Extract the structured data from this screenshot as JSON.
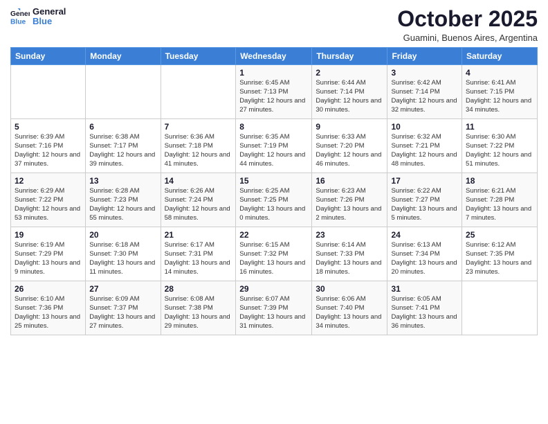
{
  "logo": {
    "line1": "General",
    "line2": "Blue"
  },
  "title": "October 2025",
  "subtitle": "Guamini, Buenos Aires, Argentina",
  "days_header": [
    "Sunday",
    "Monday",
    "Tuesday",
    "Wednesday",
    "Thursday",
    "Friday",
    "Saturday"
  ],
  "weeks": [
    [
      {
        "num": "",
        "info": ""
      },
      {
        "num": "",
        "info": ""
      },
      {
        "num": "",
        "info": ""
      },
      {
        "num": "1",
        "info": "Sunrise: 6:45 AM\nSunset: 7:13 PM\nDaylight: 12 hours\nand 27 minutes."
      },
      {
        "num": "2",
        "info": "Sunrise: 6:44 AM\nSunset: 7:14 PM\nDaylight: 12 hours\nand 30 minutes."
      },
      {
        "num": "3",
        "info": "Sunrise: 6:42 AM\nSunset: 7:14 PM\nDaylight: 12 hours\nand 32 minutes."
      },
      {
        "num": "4",
        "info": "Sunrise: 6:41 AM\nSunset: 7:15 PM\nDaylight: 12 hours\nand 34 minutes."
      }
    ],
    [
      {
        "num": "5",
        "info": "Sunrise: 6:39 AM\nSunset: 7:16 PM\nDaylight: 12 hours\nand 37 minutes."
      },
      {
        "num": "6",
        "info": "Sunrise: 6:38 AM\nSunset: 7:17 PM\nDaylight: 12 hours\nand 39 minutes."
      },
      {
        "num": "7",
        "info": "Sunrise: 6:36 AM\nSunset: 7:18 PM\nDaylight: 12 hours\nand 41 minutes."
      },
      {
        "num": "8",
        "info": "Sunrise: 6:35 AM\nSunset: 7:19 PM\nDaylight: 12 hours\nand 44 minutes."
      },
      {
        "num": "9",
        "info": "Sunrise: 6:33 AM\nSunset: 7:20 PM\nDaylight: 12 hours\nand 46 minutes."
      },
      {
        "num": "10",
        "info": "Sunrise: 6:32 AM\nSunset: 7:21 PM\nDaylight: 12 hours\nand 48 minutes."
      },
      {
        "num": "11",
        "info": "Sunrise: 6:30 AM\nSunset: 7:22 PM\nDaylight: 12 hours\nand 51 minutes."
      }
    ],
    [
      {
        "num": "12",
        "info": "Sunrise: 6:29 AM\nSunset: 7:22 PM\nDaylight: 12 hours\nand 53 minutes."
      },
      {
        "num": "13",
        "info": "Sunrise: 6:28 AM\nSunset: 7:23 PM\nDaylight: 12 hours\nand 55 minutes."
      },
      {
        "num": "14",
        "info": "Sunrise: 6:26 AM\nSunset: 7:24 PM\nDaylight: 12 hours\nand 58 minutes."
      },
      {
        "num": "15",
        "info": "Sunrise: 6:25 AM\nSunset: 7:25 PM\nDaylight: 13 hours\nand 0 minutes."
      },
      {
        "num": "16",
        "info": "Sunrise: 6:23 AM\nSunset: 7:26 PM\nDaylight: 13 hours\nand 2 minutes."
      },
      {
        "num": "17",
        "info": "Sunrise: 6:22 AM\nSunset: 7:27 PM\nDaylight: 13 hours\nand 5 minutes."
      },
      {
        "num": "18",
        "info": "Sunrise: 6:21 AM\nSunset: 7:28 PM\nDaylight: 13 hours\nand 7 minutes."
      }
    ],
    [
      {
        "num": "19",
        "info": "Sunrise: 6:19 AM\nSunset: 7:29 PM\nDaylight: 13 hours\nand 9 minutes."
      },
      {
        "num": "20",
        "info": "Sunrise: 6:18 AM\nSunset: 7:30 PM\nDaylight: 13 hours\nand 11 minutes."
      },
      {
        "num": "21",
        "info": "Sunrise: 6:17 AM\nSunset: 7:31 PM\nDaylight: 13 hours\nand 14 minutes."
      },
      {
        "num": "22",
        "info": "Sunrise: 6:15 AM\nSunset: 7:32 PM\nDaylight: 13 hours\nand 16 minutes."
      },
      {
        "num": "23",
        "info": "Sunrise: 6:14 AM\nSunset: 7:33 PM\nDaylight: 13 hours\nand 18 minutes."
      },
      {
        "num": "24",
        "info": "Sunrise: 6:13 AM\nSunset: 7:34 PM\nDaylight: 13 hours\nand 20 minutes."
      },
      {
        "num": "25",
        "info": "Sunrise: 6:12 AM\nSunset: 7:35 PM\nDaylight: 13 hours\nand 23 minutes."
      }
    ],
    [
      {
        "num": "26",
        "info": "Sunrise: 6:10 AM\nSunset: 7:36 PM\nDaylight: 13 hours\nand 25 minutes."
      },
      {
        "num": "27",
        "info": "Sunrise: 6:09 AM\nSunset: 7:37 PM\nDaylight: 13 hours\nand 27 minutes."
      },
      {
        "num": "28",
        "info": "Sunrise: 6:08 AM\nSunset: 7:38 PM\nDaylight: 13 hours\nand 29 minutes."
      },
      {
        "num": "29",
        "info": "Sunrise: 6:07 AM\nSunset: 7:39 PM\nDaylight: 13 hours\nand 31 minutes."
      },
      {
        "num": "30",
        "info": "Sunrise: 6:06 AM\nSunset: 7:40 PM\nDaylight: 13 hours\nand 34 minutes."
      },
      {
        "num": "31",
        "info": "Sunrise: 6:05 AM\nSunset: 7:41 PM\nDaylight: 13 hours\nand 36 minutes."
      },
      {
        "num": "",
        "info": ""
      }
    ]
  ]
}
